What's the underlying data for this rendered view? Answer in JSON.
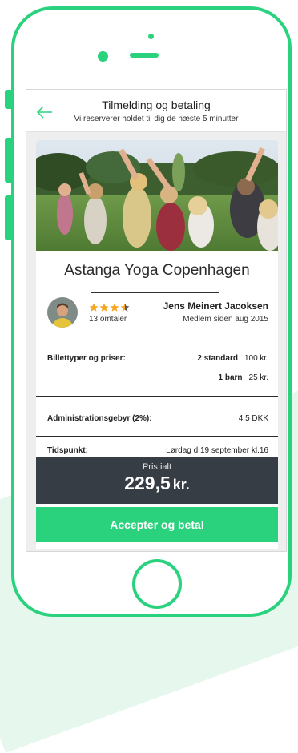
{
  "header": {
    "title": "Tilmelding og betaling",
    "subtitle": "Vi reserverer holdet til dig de næste 5 minutter",
    "back_icon": "arrow-left-icon"
  },
  "event": {
    "name": "Astanga Yoga Copenhagen"
  },
  "host": {
    "rating": 3.5,
    "rating_max": 4,
    "reviews": "13 omtaler",
    "name": "Jens Meinert Jacoksen",
    "member_since": "Medlem siden aug 2015"
  },
  "tickets": {
    "label": "Billettyper og priser:",
    "rows": [
      {
        "type": "2 standard",
        "price": "100 kr."
      },
      {
        "type": "1 barn",
        "price": "25 kr."
      }
    ]
  },
  "fee": {
    "label": "Administrationsgebyr (2%):",
    "value": "4,5 DKK"
  },
  "time": {
    "label": "Tidspunkt:",
    "value": "Lørdag d.19 september kl.16"
  },
  "total": {
    "label": "Pris ialt",
    "amount": "229,5",
    "unit": "kr."
  },
  "cta": {
    "label": "Accepter og betal"
  },
  "colors": {
    "accent": "#2bd27d",
    "dark_bar": "#363d45",
    "star": "#f5a623"
  }
}
